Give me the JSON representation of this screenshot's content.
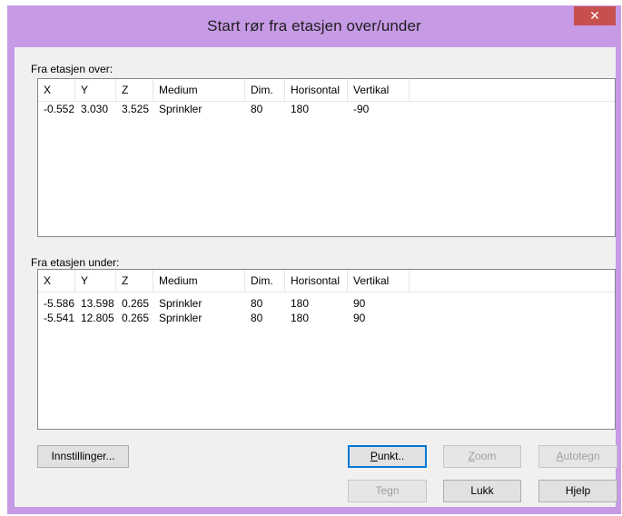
{
  "window": {
    "title": "Start rør fra etasjen over/under",
    "close_glyph": "✕"
  },
  "columns": [
    "X",
    "Y",
    "Z",
    "Medium",
    "Dim.",
    "Horisontal",
    "Vertikal"
  ],
  "above": {
    "label": "Fra etasjen over:",
    "rows": [
      [
        "-0.552",
        "3.030",
        "3.525",
        "Sprinkler",
        "80",
        "180",
        "-90"
      ]
    ]
  },
  "below": {
    "label": "Fra etasjen under:",
    "rows": [
      [
        "-5.586",
        "13.598",
        "0.265",
        "Sprinkler",
        "80",
        "180",
        "90"
      ],
      [
        "-5.541",
        "12.805",
        "0.265",
        "Sprinkler",
        "80",
        "180",
        "90"
      ]
    ]
  },
  "buttons": {
    "settings": "Innstillinger...",
    "punkt_accel": "P",
    "punkt_rest": "unkt..",
    "zoom_accel": "Z",
    "zoom_rest": "oom",
    "autotegn_accel": "A",
    "autotegn_rest": "utotegn",
    "tegn": "Tegn",
    "lukk": "Lukk",
    "hjelp_pre": "H",
    "hjelp_accel": "j",
    "hjelp_rest": "elp"
  },
  "colors": {
    "titlebar": "#c79ae6",
    "close": "#c7504f",
    "dialog_bg": "#f0f0f0"
  }
}
